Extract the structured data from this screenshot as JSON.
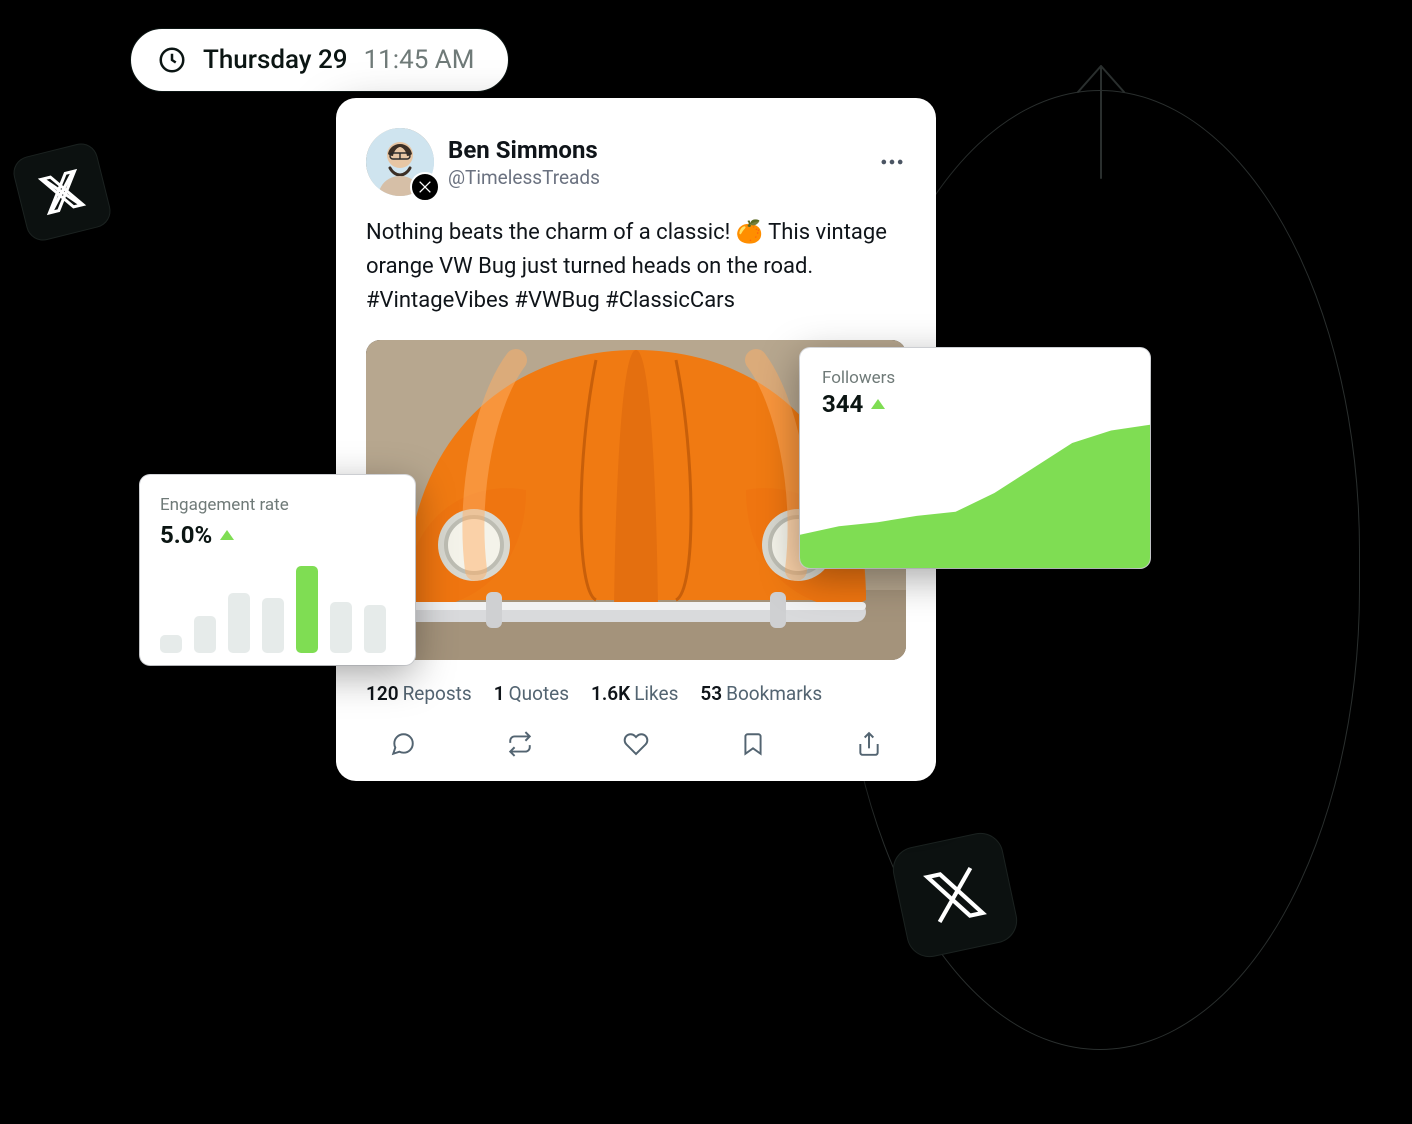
{
  "datePill": {
    "day": "Thursday 29",
    "time": "11:45 AM"
  },
  "tweet": {
    "author": {
      "display_name": "Ben Simmons",
      "handle": "@TimelessTreads"
    },
    "text": "Nothing beats the charm of a classic! 🍊 This vintage orange VW Bug just turned heads on the road. #VintageVibes #VWBug #ClassicCars",
    "metrics": {
      "reposts_count": "120",
      "reposts_label": "Reposts",
      "quotes_count": "1",
      "quotes_label": "Quotes",
      "likes_count": "1.6K",
      "likes_label": "Likes",
      "bookmarks_count": "53",
      "bookmarks_label": "Bookmarks"
    }
  },
  "engagement": {
    "label": "Engagement rate",
    "value": "5.0%"
  },
  "followers": {
    "label": "Followers",
    "value": "344"
  },
  "chart_data": [
    {
      "type": "bar",
      "title": "Engagement rate",
      "categories": [
        "1",
        "2",
        "3",
        "4",
        "5",
        "6",
        "7"
      ],
      "values": [
        20,
        40,
        65,
        60,
        95,
        55,
        52
      ],
      "highlight_index": 4,
      "ylim": [
        0,
        100
      ]
    },
    {
      "type": "area",
      "title": "Followers",
      "x": [
        0,
        1,
        2,
        3,
        4,
        5,
        6,
        7,
        8,
        9
      ],
      "values": [
        80,
        100,
        110,
        125,
        135,
        180,
        240,
        300,
        330,
        344
      ],
      "ylim": [
        0,
        360
      ]
    }
  ],
  "colors": {
    "accent_green": "#7fdd53",
    "muted_bar": "#e6ebea",
    "text_muted": "#6f7a78"
  }
}
